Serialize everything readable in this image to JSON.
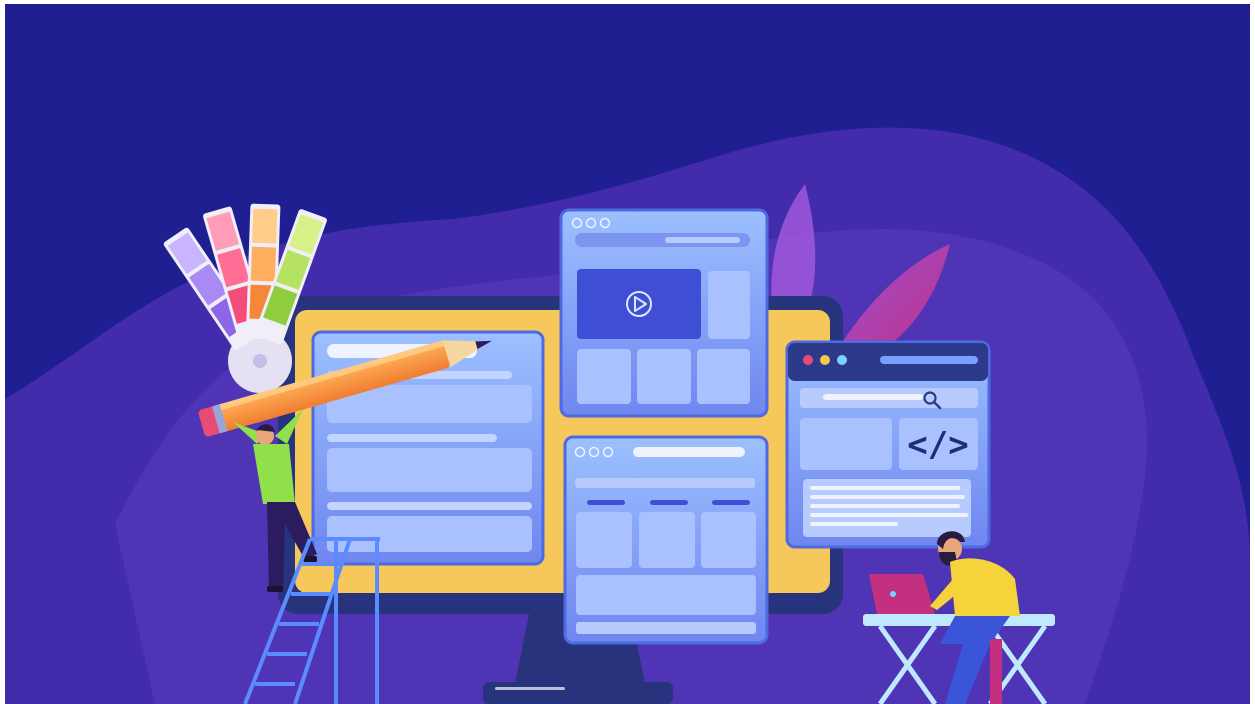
{
  "illustration": {
    "subject": "web-design-and-development",
    "code_symbol": "</>",
    "icons": [
      "color-swatch-fan",
      "pencil",
      "play-icon",
      "search-icon",
      "code-icon",
      "laptop",
      "ladder",
      "monitor"
    ],
    "colors": {
      "background": "#1f1f91",
      "blob": "#4a2fb0",
      "monitor_screen": "#f6c75a",
      "window": "#8fb1ff",
      "window_dark": "#2d3a8c",
      "accent_pink": "#c2307f",
      "accent_yellow": "#f4c84a",
      "accent_green": "#8fe04a"
    }
  }
}
